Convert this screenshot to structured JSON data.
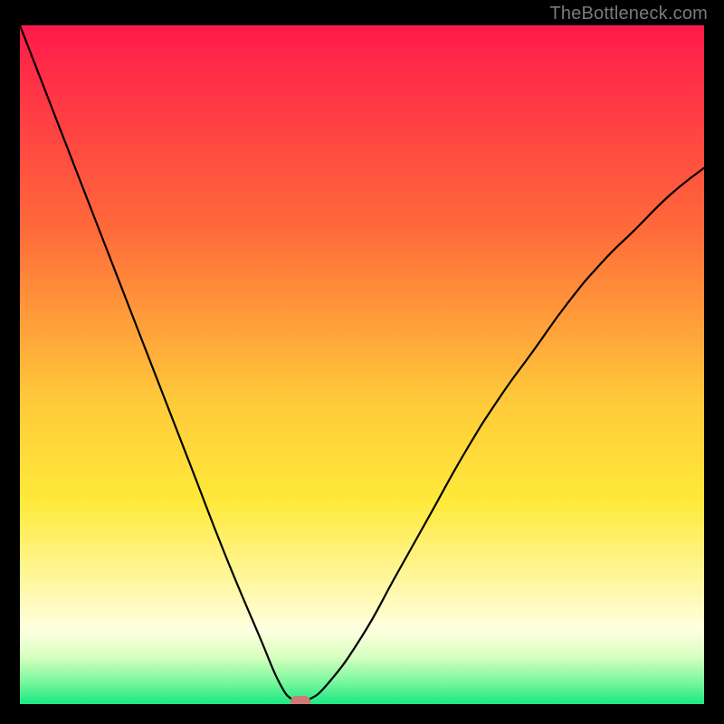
{
  "watermark": "TheBottleneck.com",
  "chart_data": {
    "type": "line",
    "title": "",
    "xlabel": "",
    "ylabel": "",
    "xlim": [
      0,
      100
    ],
    "ylim": [
      0,
      100
    ],
    "series": [
      {
        "name": "curve",
        "x": [
          0,
          5,
          10,
          15,
          20,
          25,
          30,
          35,
          38,
          40,
          41,
          42,
          45,
          50,
          55,
          60,
          65,
          70,
          75,
          80,
          85,
          90,
          95,
          100
        ],
        "y": [
          100,
          87,
          74,
          61,
          48,
          35,
          22,
          10,
          3,
          0.5,
          0,
          0.5,
          3,
          10,
          19,
          28,
          37,
          45,
          52,
          59,
          65,
          70,
          75,
          79
        ]
      }
    ],
    "marker": {
      "x": 41,
      "y": 0
    },
    "gradient_stops": [
      {
        "offset": 0.0,
        "color": "#ff1a4b"
      },
      {
        "offset": 0.3,
        "color": "#ff6a3a"
      },
      {
        "offset": 0.55,
        "color": "#ffc93a"
      },
      {
        "offset": 0.7,
        "color": "#ffe93a"
      },
      {
        "offset": 0.82,
        "color": "#fff7a0"
      },
      {
        "offset": 0.89,
        "color": "#ffffe0"
      },
      {
        "offset": 0.93,
        "color": "#d8ffc0"
      },
      {
        "offset": 0.965,
        "color": "#80f8a0"
      },
      {
        "offset": 1.0,
        "color": "#1ae882"
      }
    ]
  }
}
